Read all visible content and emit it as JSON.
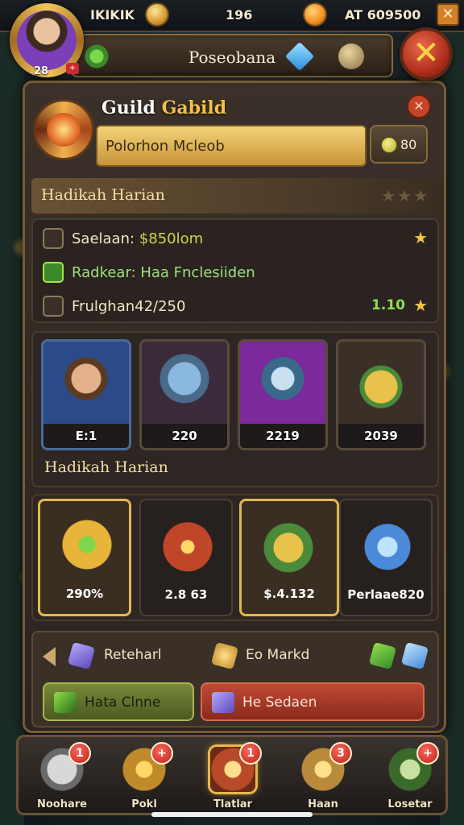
{
  "topbar": {
    "player_name": "IKIKIK",
    "coins": "196",
    "gold": "AT 609500",
    "level": "28",
    "close_label": "✕"
  },
  "header": {
    "title": "Poseobana"
  },
  "guild": {
    "title_prefix": "Guild",
    "title_suffix": "Gabild",
    "name": "Polorhon Mcleob",
    "member_count": "80",
    "close_label": "✕"
  },
  "section1": {
    "title": "Hadikah Harian"
  },
  "info": {
    "salary_label": "Saelaan:",
    "salary_value": "$850lom",
    "reward_label": "Radkear:",
    "reward_value": "Haa Fnclesiiden",
    "progress_label": "Frulghan42/250",
    "progress_value": "1.10"
  },
  "members": {
    "label": "Hadikah Harian",
    "cards": [
      {
        "value": "E:1"
      },
      {
        "value": "220"
      },
      {
        "value": "2219"
      },
      {
        "value": "2039"
      }
    ]
  },
  "rewards": [
    {
      "value": "290%"
    },
    {
      "value": "2.8 63"
    },
    {
      "value": "$.4.132"
    },
    {
      "value": "Perlaae820"
    }
  ],
  "actions": {
    "item1": "Reteharl",
    "item2": "Eo Markd",
    "button_green": "Hata Clnne",
    "button_red": "He Sedaen"
  },
  "nav": [
    {
      "label": "Noohare",
      "badge": "1"
    },
    {
      "label": "Pokl",
      "badge": "+"
    },
    {
      "label": "Tlatlar",
      "badge": "1"
    },
    {
      "label": "Haan",
      "badge": "3"
    },
    {
      "label": "Losetar",
      "badge": "+"
    }
  ],
  "colors": {
    "gold": "#f3c14a",
    "panel": "#3b302a",
    "green": "#7bd84a",
    "red": "#c04a34"
  }
}
